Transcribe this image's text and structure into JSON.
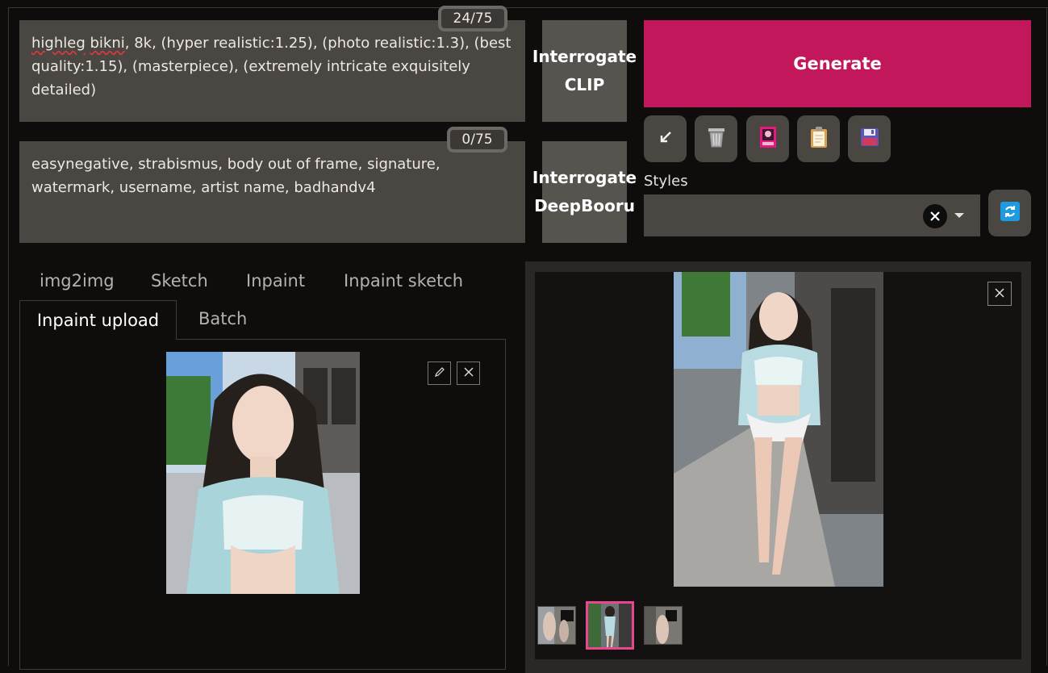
{
  "prompts": {
    "positive": {
      "text_words": [
        "highleg",
        "bikni"
      ],
      "text_rest": ", 8k, (hyper realistic:1.25), (photo realistic:1.3), (best quality:1.15), (masterpiece), (extremely intricate exquisitely detailed)",
      "token_counter": "24/75"
    },
    "negative": {
      "text": "easynegative, strabismus, body out of frame, signature, watermark, username, artist name, badhandv4",
      "token_counter": "0/75"
    }
  },
  "interrogate": {
    "clip_line1": "Interrogate",
    "clip_line2": "CLIP",
    "deepbooru_line1": "Interrogate",
    "deepbooru_line2": "DeepBooru"
  },
  "generate": {
    "label": "Generate",
    "color": "#c2185b"
  },
  "toolbar": {
    "icons": [
      "arrow-down-left-icon",
      "trash-icon",
      "image-icon",
      "clipboard-icon",
      "save-icon"
    ]
  },
  "styles": {
    "label": "Styles",
    "value": ""
  },
  "tabs": {
    "row1": [
      "img2img",
      "Sketch",
      "Inpaint",
      "Inpaint sketch"
    ],
    "row2": [
      "Inpaint upload",
      "Batch"
    ],
    "active": "Inpaint upload"
  },
  "gallery": {
    "thumbnail_count": 3,
    "selected_thumbnail": 2,
    "selected_color": "#e8478f"
  }
}
